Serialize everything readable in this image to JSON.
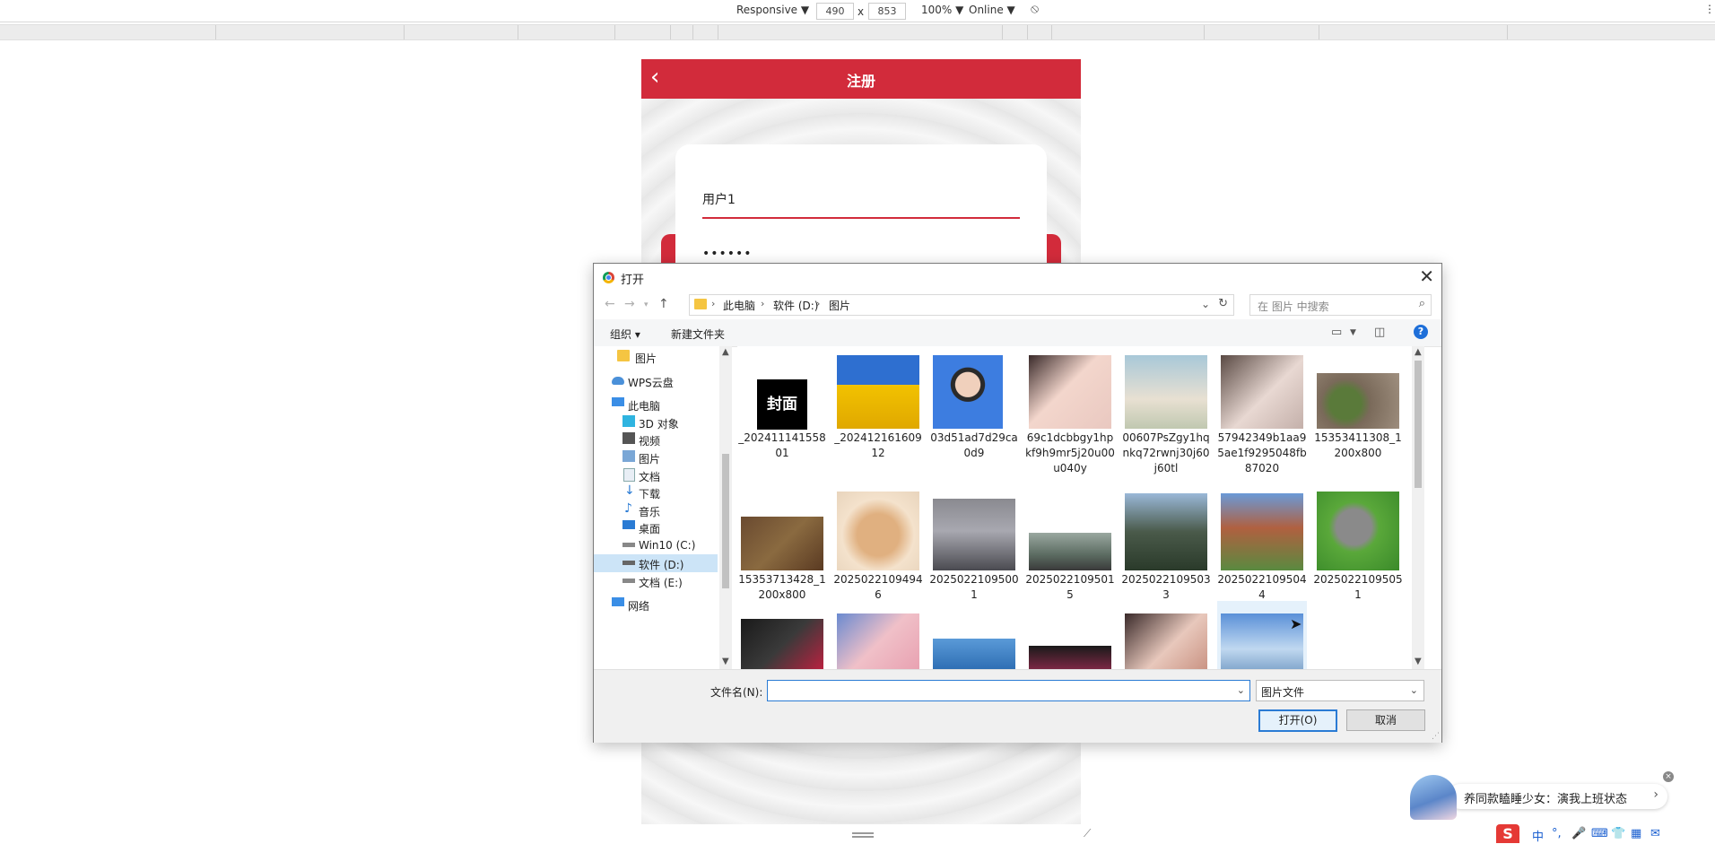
{
  "devtools": {
    "mode": "Responsive ▼",
    "width": "490",
    "times": "x",
    "height": "853",
    "zoom": "100% ▼",
    "network": "Online ▼",
    "more": "⋮"
  },
  "phone": {
    "header_title": "注册",
    "back": "‹",
    "username": "用户1",
    "password": "••••••"
  },
  "dialog": {
    "title": "打开",
    "close": "✕",
    "breadcrumb": [
      "此电脑",
      "软件 (D:)",
      "图片"
    ],
    "search_placeholder": "在 图片 中搜索",
    "toolbar": {
      "organize": "组织 ▾",
      "new_folder": "新建文件夹",
      "help": "?"
    },
    "nav_items": [
      {
        "label": "图片",
        "icon": "folder-icon"
      },
      {
        "label": "WPS云盘",
        "icon": "cloud-icon"
      },
      {
        "label": "此电脑",
        "icon": "computer-icon"
      },
      {
        "label": "3D 对象",
        "icon": "cube-icon"
      },
      {
        "label": "视频",
        "icon": "video-icon"
      },
      {
        "label": "图片",
        "icon": "pictures-icon"
      },
      {
        "label": "文档",
        "icon": "document-icon"
      },
      {
        "label": "下载",
        "icon": "download-icon"
      },
      {
        "label": "音乐",
        "icon": "music-icon"
      },
      {
        "label": "桌面",
        "icon": "desktop-icon"
      },
      {
        "label": "Win10 (C:)",
        "icon": "drive-icon"
      },
      {
        "label": "软件 (D:)",
        "icon": "drive-icon",
        "selected": true
      },
      {
        "label": "文档 (E:)",
        "icon": "drive-icon"
      },
      {
        "label": "网络",
        "icon": "network-icon"
      }
    ],
    "files": [
      {
        "name": "_20241114155801",
        "thumb": "black-cover-text",
        "cover_text": "封面"
      },
      {
        "name": "_20241216160912",
        "thumb": "basketball-player"
      },
      {
        "name": "03d51ad7d29ca0d9",
        "thumb": "boy-portrait"
      },
      {
        "name": "69c1dcbbgy1hpkf9h9mr5j20u00u040y",
        "thumb": "girl-portrait"
      },
      {
        "name": "00607PsZgy1hqnkq72rwnj30j60j60tl",
        "thumb": "girl-outdoor"
      },
      {
        "name": "57942349b1aa95ae1f9295048fb87020",
        "thumb": "girl-closeup"
      },
      {
        "name": "15353411308_1200x800",
        "thumb": "green-tea-bowls"
      },
      {
        "name": "15353713428_1200x800",
        "thumb": "tea-leaves"
      },
      {
        "name": "20250221094946",
        "thumb": "hamster"
      },
      {
        "name": "20250221095001",
        "thumb": "sports-car"
      },
      {
        "name": "20250221095015",
        "thumb": "motorcycles"
      },
      {
        "name": "20250221095033",
        "thumb": "mountain-rocks"
      },
      {
        "name": "20250221095044",
        "thumb": "house"
      },
      {
        "name": "20250221095051",
        "thumb": "kitten"
      },
      {
        "name": "",
        "thumb": "gpu-box"
      },
      {
        "name": "",
        "thumb": "girl-pink"
      },
      {
        "name": "",
        "thumb": "blue-train"
      },
      {
        "name": "",
        "thumb": "opera-mask"
      },
      {
        "name": "",
        "thumb": "girl-redlips"
      },
      {
        "name": "",
        "thumb": "sky-clouds",
        "hovered": true
      }
    ],
    "filename_label": "文件名(N):",
    "filename_value": "",
    "filetype": "图片文件",
    "open_button": "打开(O)",
    "cancel_button": "取消"
  },
  "ad": {
    "text": "养同款瞌睡少女：演我上班状态",
    "arrow": "›",
    "close": "×"
  },
  "ime": {
    "logo": "S",
    "items": [
      "中",
      "°,",
      "🎤",
      "⌨",
      "👕",
      "▦",
      "✉"
    ]
  },
  "colors": {
    "brand_red": "#d22b3b",
    "selection_blue": "#cce4f7",
    "accent_blue": "#2a7bd4"
  }
}
